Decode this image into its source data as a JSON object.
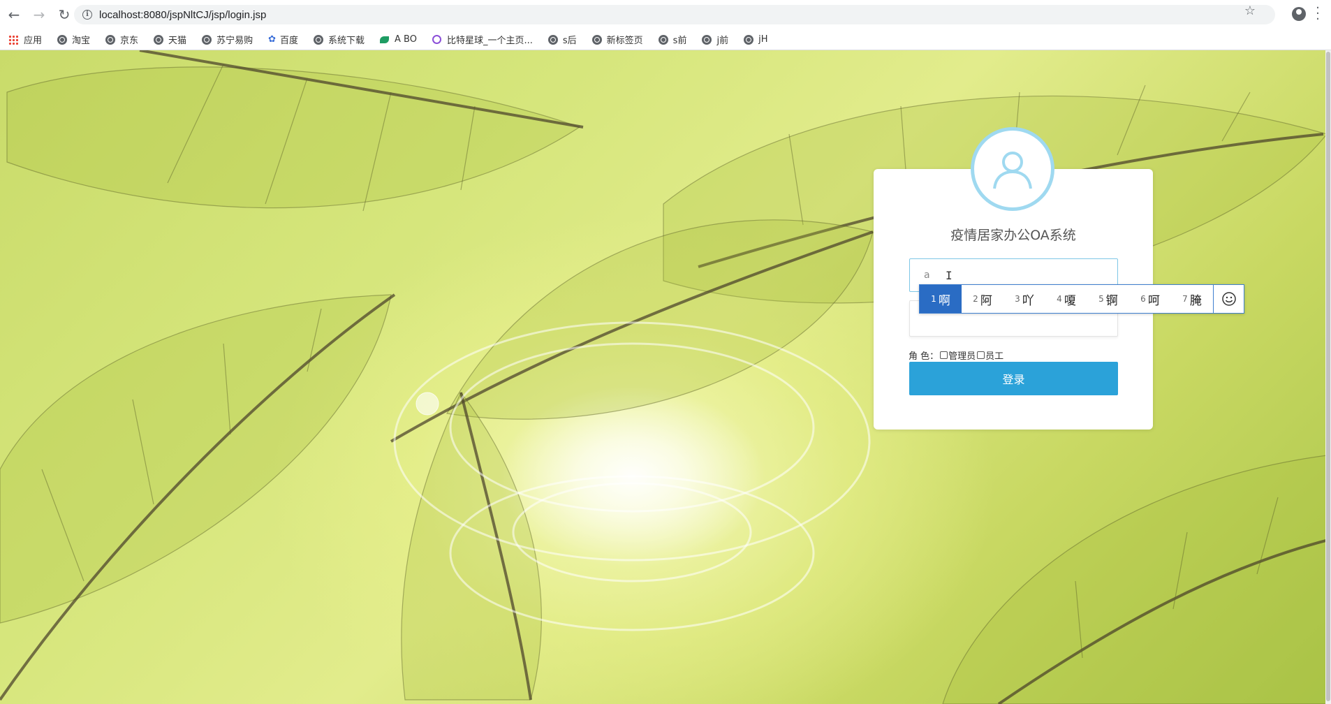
{
  "browser": {
    "url": "localhost:8080/jspNltCJ/jsp/login.jsp",
    "bookmarks": [
      "应用",
      "淘宝",
      "京东",
      "天猫",
      "苏宁易购",
      "百度",
      "系统下载",
      "A BO",
      "比特星球_一个主页...",
      "s后",
      "新标签页",
      "s前",
      "j前",
      "jH"
    ]
  },
  "login": {
    "title": "疫情居家办公OA系统",
    "username_value": "a",
    "role_label": "角 色：",
    "role_admin": "管理员",
    "role_staff": "员工",
    "submit_label": "登录"
  },
  "ime": {
    "candidates": [
      {
        "num": "1",
        "char": "啊"
      },
      {
        "num": "2",
        "char": "阿"
      },
      {
        "num": "3",
        "char": "吖"
      },
      {
        "num": "4",
        "char": "嗄"
      },
      {
        "num": "5",
        "char": "锕"
      },
      {
        "num": "6",
        "char": "呵"
      },
      {
        "num": "7",
        "char": "腌"
      }
    ]
  },
  "colors": {
    "accent": "#2ba2d9",
    "avatar_ring": "#9fd9f0",
    "ime_selected": "#2a6cc4"
  }
}
